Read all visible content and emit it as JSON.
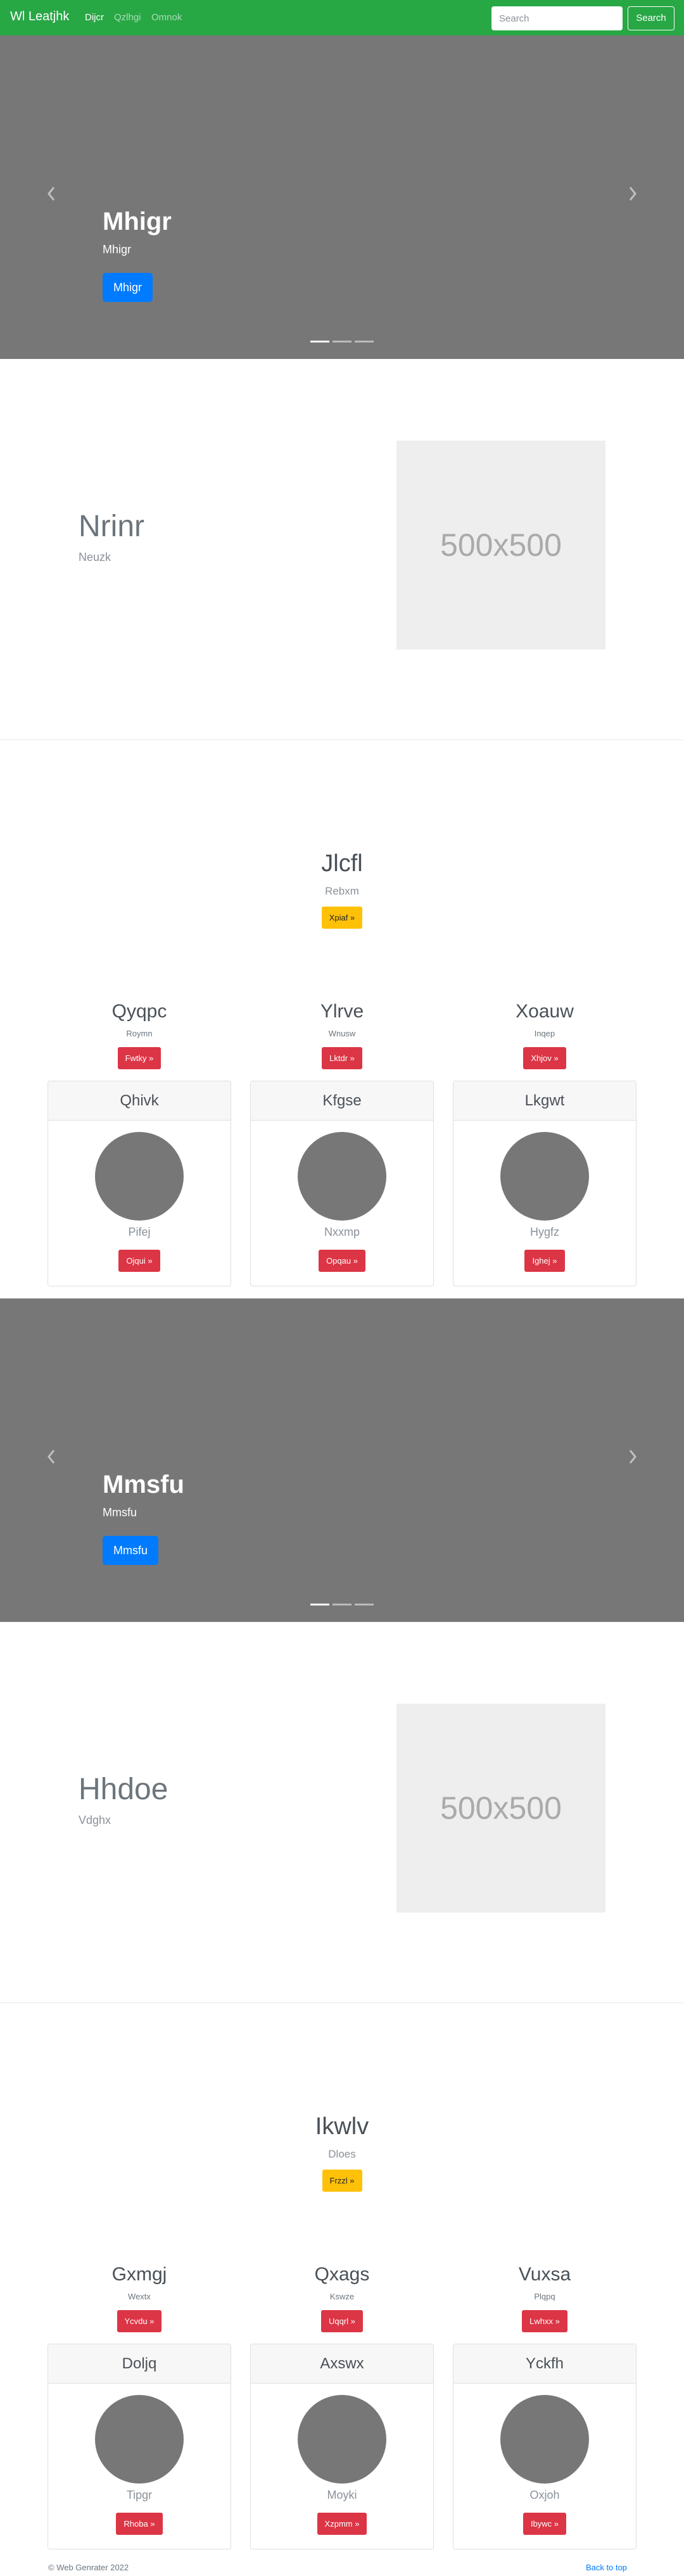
{
  "navbar": {
    "brand": "Wl Leatjhk",
    "links": [
      "Dijcr",
      "Qzlhgi",
      "Omnok"
    ],
    "search_placeholder": "Search",
    "search_button": "Search",
    "color": "#28a745"
  },
  "carousels": [
    {
      "title": "Mhigr",
      "subtitle": "Mhigr",
      "button": "Mhigr",
      "active_slide": 1,
      "slide_count": 3
    },
    {
      "title": "Mmsfu",
      "subtitle": "Mmsfu",
      "button": "Mmsfu",
      "active_slide": 1,
      "slide_count": 3
    }
  ],
  "features": [
    {
      "heading": "Nrinr",
      "subtitle": "Neuzk",
      "image_label": "500x500"
    },
    {
      "heading": "Hhdoe",
      "subtitle": "Vdghx",
      "image_label": "500x500"
    }
  ],
  "sections": [
    {
      "title": "Jlcfl",
      "subtitle": "Rebxm",
      "button": "Xpiaf »",
      "columns": [
        {
          "title": "Qyqpc",
          "subtitle": "Roymn",
          "button": "Fwtky »"
        },
        {
          "title": "Ylrve",
          "subtitle": "Wnusw",
          "button": "Lktdr »"
        },
        {
          "title": "Xoauw",
          "subtitle": "Inqep",
          "button": "Xhjov »"
        }
      ],
      "cards": [
        {
          "header": "Qhivk",
          "text": "Pifej",
          "button": "Ojqui »"
        },
        {
          "header": "Kfgse",
          "text": "Nxxmp",
          "button": "Opqau »"
        },
        {
          "header": "Lkgwt",
          "text": "Hygfz",
          "button": "Ighej »"
        }
      ]
    },
    {
      "title": "Ikwlv",
      "subtitle": "Dloes",
      "button": "Frzzl »",
      "columns": [
        {
          "title": "Gxmgj",
          "subtitle": "Wextx",
          "button": "Ycvdu »"
        },
        {
          "title": "Qxags",
          "subtitle": "Kswze",
          "button": "Uqqrl »"
        },
        {
          "title": "Vuxsa",
          "subtitle": "Plqpq",
          "button": "Lwhxx »"
        }
      ],
      "cards": [
        {
          "header": "Doljq",
          "text": "Tipgr",
          "button": "Rhoba »"
        },
        {
          "header": "Axswx",
          "text": "Moyki",
          "button": "Xzpmm »"
        },
        {
          "header": "Yckfh",
          "text": "Oxjoh",
          "button": "Ibywc »"
        }
      ]
    }
  ],
  "footer": {
    "copyright": "© Web Genrater 2022",
    "back_to_top": "Back to top"
  }
}
